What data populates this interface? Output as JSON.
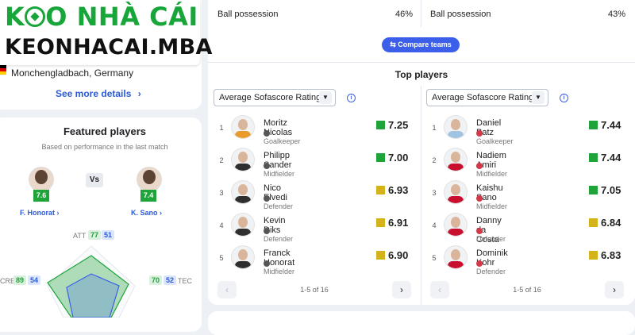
{
  "logo": {
    "line1": "KÈO NHÀ CÁI",
    "line1_prefix": "K",
    "line1_rest": "O NHÀ CÁI",
    "line2": "KEONHACAI.MBA"
  },
  "venue": {
    "location": "Monchengladbach, Germany",
    "see_more_label": "See more details",
    "see_more_icon": "chevron-right-icon"
  },
  "featured": {
    "title": "Featured players",
    "subtitle": "Based on performance in the last match",
    "vs_label": "Vs",
    "home_player": {
      "name": "F. Honorat",
      "rating": "7.6"
    },
    "away_player": {
      "name": "K. Sano",
      "rating": "7.4"
    },
    "radar": {
      "att": {
        "label": "ATT",
        "home": "77",
        "away": "51"
      },
      "tec": {
        "label": "TEC",
        "home": "70",
        "away": "52"
      },
      "cre": {
        "label": "CRE",
        "home": "89",
        "away": "54"
      }
    }
  },
  "possession": {
    "home": {
      "label": "Ball possession",
      "value": "46%"
    },
    "away": {
      "label": "Ball possession",
      "value": "43%"
    }
  },
  "compare_button": "Compare teams",
  "top_players": {
    "title": "Top players",
    "home": {
      "select_value": "Average Sofascore Rating",
      "pager": "1-5 of 16",
      "rows": [
        {
          "rank": "1",
          "name": "Moritz Nicolas",
          "position": "Goalkeeper",
          "rating": "7.25",
          "rating_color": "#1fa43a",
          "shirt": "#e89a2a"
        },
        {
          "rank": "2",
          "name": "Philipp Sander",
          "position": "Midfielder",
          "rating": "7.00",
          "rating_color": "#1fa43a",
          "shirt": "#2f2f2f"
        },
        {
          "rank": "3",
          "name": "Nico Elvedi",
          "position": "Defender",
          "rating": "6.93",
          "rating_color": "#d3b21a",
          "shirt": "#2f2f2f"
        },
        {
          "rank": "4",
          "name": "Kevin Diks",
          "position": "Defender",
          "rating": "6.91",
          "rating_color": "#d3b21a",
          "shirt": "#2f2f2f"
        },
        {
          "rank": "5",
          "name": "Franck Honorat",
          "position": "Midfielder",
          "rating": "6.90",
          "rating_color": "#d3b21a",
          "shirt": "#2f2f2f"
        }
      ]
    },
    "away": {
      "select_value": "Average Sofascore Rating",
      "pager": "1-5 of 16",
      "rows": [
        {
          "rank": "1",
          "name": "Daniel Batz",
          "position": "Goalkeeper",
          "rating": "7.44",
          "rating_color": "#1fa43a",
          "shirt": "#9fc3e0"
        },
        {
          "rank": "2",
          "name": "Nadiem Amiri",
          "position": "Midfielder",
          "rating": "7.44",
          "rating_color": "#1fa43a",
          "shirt": "#c8102e"
        },
        {
          "rank": "3",
          "name": "Kaishu Sano",
          "position": "Midfielder",
          "rating": "7.05",
          "rating_color": "#1fa43a",
          "shirt": "#c8102e"
        },
        {
          "rank": "4",
          "name": "Danny da Costa",
          "position": "Defender",
          "rating": "6.84",
          "rating_color": "#d3b21a",
          "shirt": "#c8102e"
        },
        {
          "rank": "5",
          "name": "Dominik Kohr",
          "position": "Defender",
          "rating": "6.83",
          "rating_color": "#d3b21a",
          "shirt": "#c8102e"
        }
      ]
    }
  },
  "colors": {
    "accent": "#3b5fe8",
    "rating_green": "#1fa43a",
    "rating_yellow": "#d3b21a",
    "logo_green": "#18a53a"
  }
}
